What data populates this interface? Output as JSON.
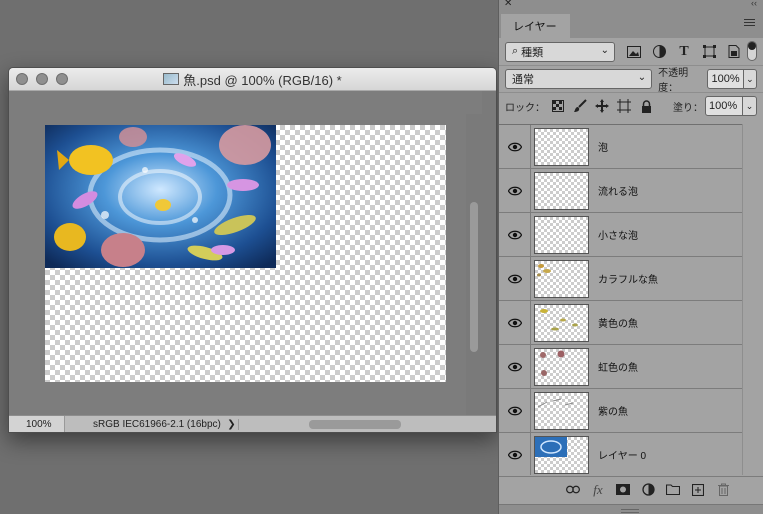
{
  "document": {
    "title": "魚.psd @ 100% (RGB/16) *",
    "zoom": "100%",
    "color_profile": "sRGB IEC61966-2.1 (16bpc)",
    "status_arrow": "❯"
  },
  "panel": {
    "close_glyph": "✕",
    "collapse_glyph": "‹‹",
    "tab_label": "レイヤー",
    "filter": {
      "kind": "種類",
      "search_glyph": "⌕"
    },
    "blend_mode": "通常",
    "opacity_label": "不透明度：",
    "opacity_value": "100%",
    "lock_label": "ロック：",
    "fill_label": "塗り：",
    "fill_value": "100%",
    "layers": [
      {
        "name": "泡",
        "visible": true,
        "thumb": "blank"
      },
      {
        "name": "流れる泡",
        "visible": true,
        "thumb": "blank"
      },
      {
        "name": "小さな泡",
        "visible": true,
        "thumb": "blank"
      },
      {
        "name": "カラフルな魚",
        "visible": true,
        "thumb": "colorful"
      },
      {
        "name": "黄色の魚",
        "visible": true,
        "thumb": "yellow"
      },
      {
        "name": "虹色の魚",
        "visible": true,
        "thumb": "rainbow"
      },
      {
        "name": "紫の魚",
        "visible": true,
        "thumb": "purple"
      },
      {
        "name": "レイヤー 0",
        "visible": true,
        "thumb": "water"
      }
    ],
    "footer_icons": [
      "link-icon",
      "fx-icon",
      "mask-icon",
      "adjustment-icon",
      "group-folder-icon",
      "new-layer-icon",
      "trash-icon"
    ],
    "fx_label": "fx"
  },
  "colors": {
    "workspace": "#6f6f6f",
    "panel": "#a3a3a3",
    "water_blue": "#2c6fb8"
  }
}
